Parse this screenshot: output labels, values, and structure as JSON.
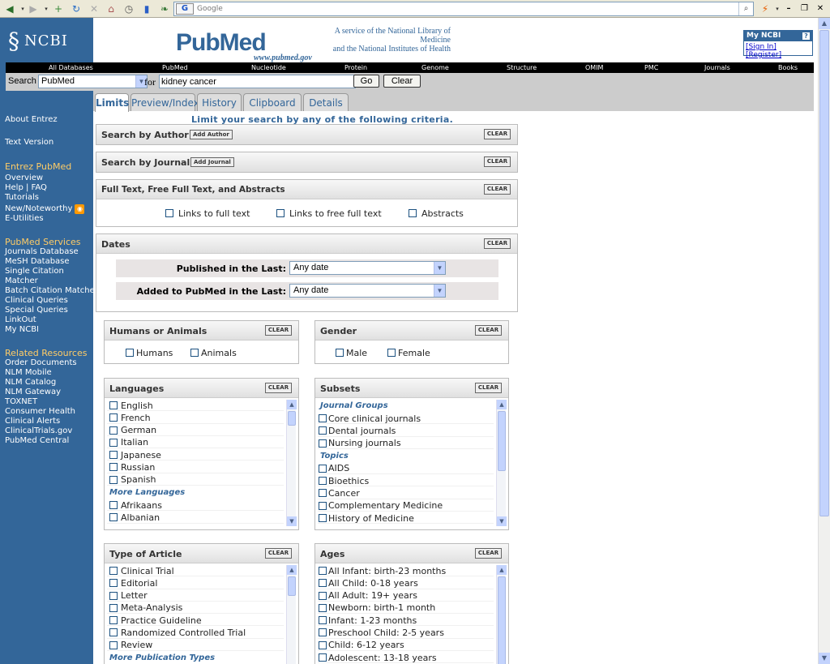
{
  "browser": {
    "address_placeholder": "Google",
    "search_engine_label": "G"
  },
  "sidebar": {
    "logo_text": "NCBI",
    "top_links": [
      "About Entrez",
      "Text Version"
    ],
    "sections": [
      {
        "heading": "Entrez PubMed",
        "links": [
          "Overview",
          "Help | FAQ",
          "Tutorials",
          "New/Noteworthy",
          "E-Utilities"
        ]
      },
      {
        "heading": "PubMed Services",
        "links": [
          "Journals Database",
          "MeSH Database",
          "Single Citation",
          "Matcher",
          "Batch Citation Matcher",
          "Clinical Queries",
          "Special Queries",
          "LinkOut",
          "My NCBI"
        ]
      },
      {
        "heading": "Related Resources",
        "links": [
          "Order Documents",
          "NLM Mobile",
          "NLM Catalog",
          "NLM Gateway",
          "TOXNET",
          "Consumer Health",
          "Clinical Alerts",
          "ClinicalTrials.gov",
          "PubMed Central"
        ]
      }
    ]
  },
  "header": {
    "logo": "PubMed",
    "url": "www.pubmed.gov",
    "service_line1": "A service of the National Library of Medicine",
    "service_line2": "and the National Institutes of Health",
    "myncbi_title": "My NCBI",
    "myncbi_help": "?",
    "sign_in": "[Sign In]",
    "register": "[Register]"
  },
  "db_bar": [
    "All Databases",
    "PubMed",
    "Nucleotide",
    "Protein",
    "Genome",
    "Structure",
    "OMIM",
    "PMC",
    "Journals",
    "Books"
  ],
  "search": {
    "label": "Search",
    "database": "PubMed",
    "for_label": "for",
    "query": "kidney cancer",
    "go": "Go",
    "clear": "Clear"
  },
  "tabs": [
    {
      "label": "Limits",
      "active": true
    },
    {
      "label": "Preview/Index",
      "active": false
    },
    {
      "label": "History",
      "active": false
    },
    {
      "label": "Clipboard",
      "active": false
    },
    {
      "label": "Details",
      "active": false
    }
  ],
  "instruction": "Limit your search by any of the following criteria.",
  "clear_label": "CLEAR",
  "panels": {
    "author": {
      "title": "Search by Author",
      "add": "Add Author"
    },
    "journal": {
      "title": "Search by Journal",
      "add": "Add Journal"
    },
    "fulltext": {
      "title": "Full Text, Free Full Text, and Abstracts",
      "options": [
        "Links to full text",
        "Links to free full text",
        "Abstracts"
      ]
    },
    "dates": {
      "title": "Dates",
      "published_label": "Published in the Last:",
      "published_value": "Any date",
      "added_label": "Added to PubMed in the Last:",
      "added_value": "Any date"
    },
    "humans": {
      "title": "Humans or Animals",
      "options": [
        "Humans",
        "Animals"
      ]
    },
    "gender": {
      "title": "Gender",
      "options": [
        "Male",
        "Female"
      ]
    },
    "languages": {
      "title": "Languages",
      "items": [
        "English",
        "French",
        "German",
        "Italian",
        "Japanese",
        "Russian",
        "Spanish"
      ],
      "group": "More Languages",
      "more_items": [
        "Afrikaans",
        "Albanian"
      ]
    },
    "subsets": {
      "title": "Subsets",
      "group1": "Journal Groups",
      "items1": [
        "Core clinical journals",
        "Dental journals",
        "Nursing journals"
      ],
      "group2": "Topics",
      "items2": [
        "AIDS",
        "Bioethics",
        "Cancer",
        "Complementary Medicine",
        "History of Medicine"
      ]
    },
    "article_type": {
      "title": "Type of Article",
      "items": [
        "Clinical Trial",
        "Editorial",
        "Letter",
        "Meta-Analysis",
        "Practice Guideline",
        "Randomized Controlled Trial",
        "Review"
      ],
      "group": "More Publication Types"
    },
    "ages": {
      "title": "Ages",
      "items": [
        "All Infant: birth-23 months",
        "All Child: 0-18 years",
        "All Adult: 19+ years",
        "Newborn: birth-1 month",
        "Infant: 1-23 months",
        "Preschool Child: 2-5 years",
        "Child: 6-12 years",
        "Adolescent: 13-18 years"
      ]
    }
  }
}
